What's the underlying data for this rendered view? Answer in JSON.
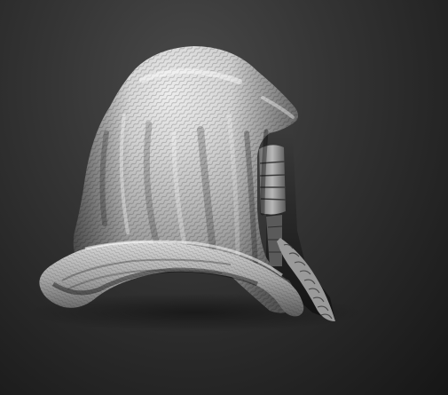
{
  "scene": {
    "subject": "hood-sculpt",
    "colors": {
      "background_center": "#4a4a4a",
      "background_edge": "#161616",
      "hood_highlight": "#f2f2f2",
      "hood_mid": "#bdbdbd",
      "hood_shadow": "#4a4a4a",
      "inner_dark": "#1e1e1e"
    },
    "icons": [
      "hood-sculpt",
      "face-plate",
      "fabric-texture"
    ]
  }
}
